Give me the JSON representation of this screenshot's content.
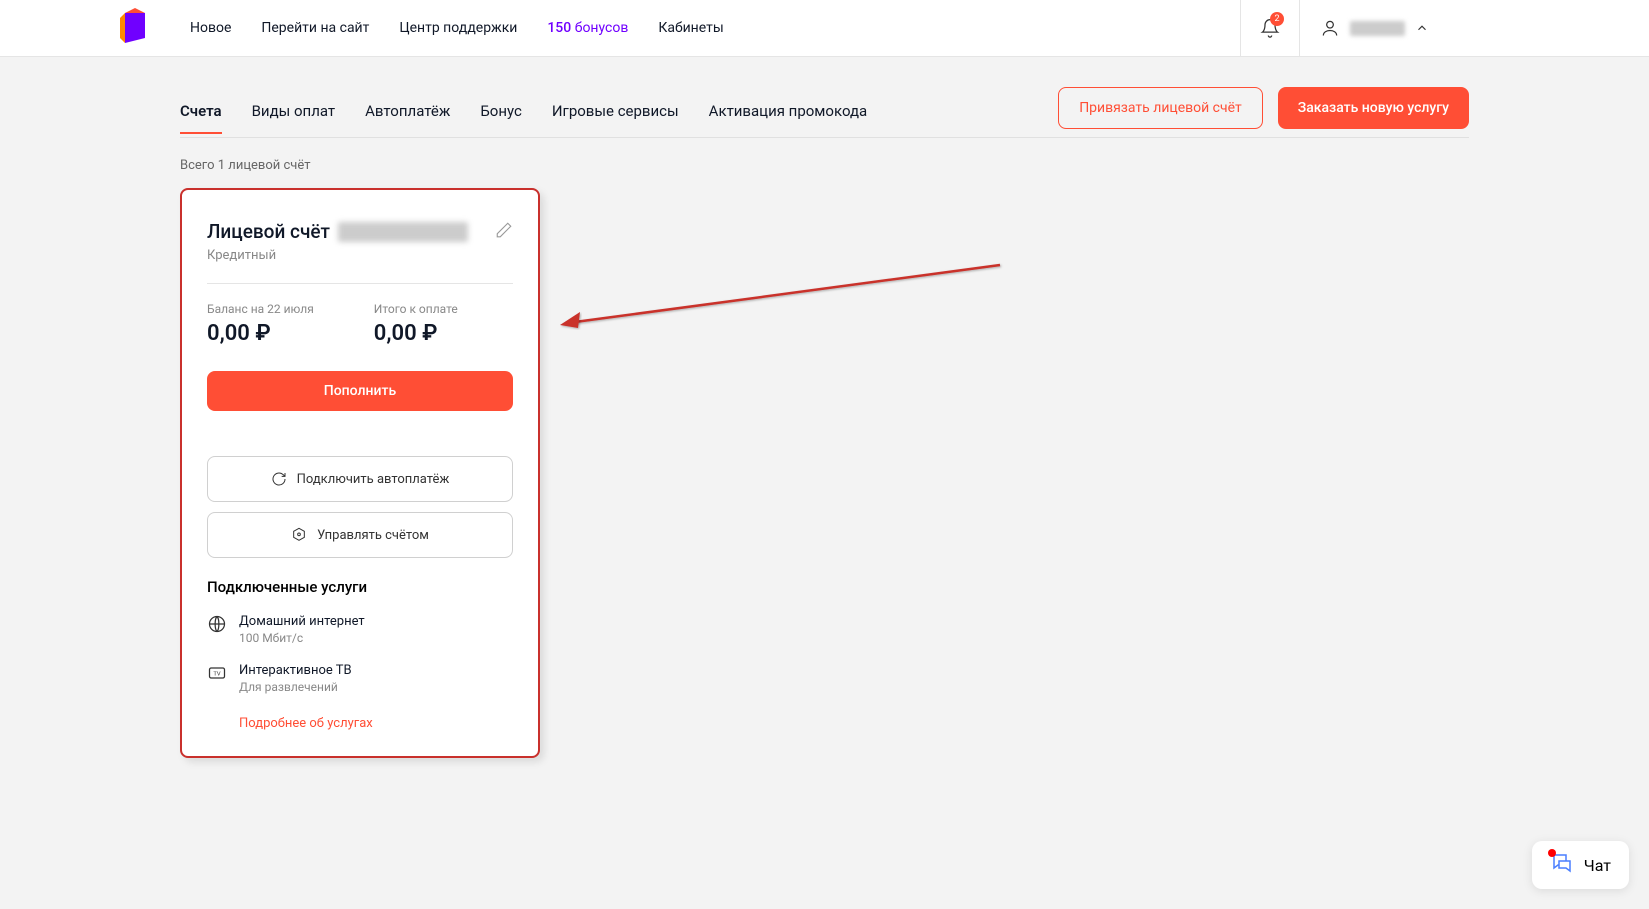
{
  "header": {
    "nav": [
      "Новое",
      "Перейти на сайт",
      "Центр поддержки"
    ],
    "bonus_count": "150",
    "bonus_text": "бонусов",
    "cabinets": "Кабинеты",
    "notif_count": "2"
  },
  "subnav": {
    "tabs": [
      "Счета",
      "Виды оплат",
      "Автоплатёж",
      "Бонус",
      "Игровые сервисы",
      "Активация промокода"
    ],
    "link_account": "Привязать лицевой счёт",
    "order_service": "Заказать новую услугу"
  },
  "summary": "Всего 1 лицевой счёт",
  "card": {
    "title": "Лицевой счёт",
    "type": "Кредитный",
    "balance_label": "Баланс на 22 июля",
    "balance_value": "0,00 ₽",
    "total_label": "Итого к оплате",
    "total_value": "0,00 ₽",
    "top_up": "Пополнить",
    "autopay": "Подключить автоплатёж",
    "manage": "Управлять счётом",
    "services_title": "Подключенные услуги",
    "service1_name": "Домашний интернет",
    "service1_detail": "100 Мбит/с",
    "service2_name": "Интерактивное ТВ",
    "service2_detail": "Для развлечений",
    "more_link": "Подробнее об услугах"
  },
  "chat": {
    "label": "Чат"
  }
}
